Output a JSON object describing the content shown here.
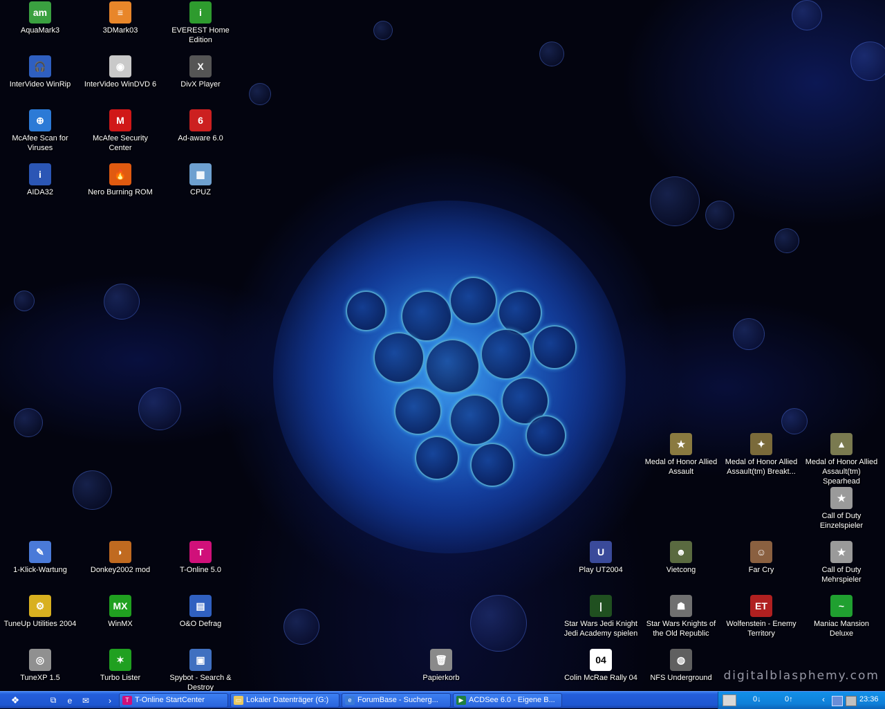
{
  "desktop": {
    "watermark": "digitalblasphemy.com",
    "icons": [
      {
        "label": "AquaMark3",
        "icon": "aquamark-icon",
        "color": "#3aa040",
        "glyph": "am"
      },
      {
        "label": "3DMark03",
        "icon": "3dmark-icon",
        "color": "#e8862a",
        "glyph": "≡"
      },
      {
        "label": "EVEREST Home Edition",
        "icon": "info-icon",
        "color": "#2e9b2e",
        "glyph": "i"
      },
      {
        "label": "InterVideo WinRip",
        "icon": "headphones-icon",
        "color": "#2f5fc0",
        "glyph": "🎧"
      },
      {
        "label": "InterVideo WinDVD 6",
        "icon": "dvd-icon",
        "color": "#c9c9c9",
        "glyph": "◉"
      },
      {
        "label": "DivX Player",
        "icon": "divx-icon",
        "color": "#555555",
        "glyph": "X"
      },
      {
        "label": "McAfee Scan for Viruses",
        "icon": "scan-target-icon",
        "color": "#2c7ad6",
        "glyph": "⊕"
      },
      {
        "label": "McAfee Security Center",
        "icon": "mcafee-icon",
        "color": "#d01818",
        "glyph": "M"
      },
      {
        "label": "Ad-aware 6.0",
        "icon": "adaware-icon",
        "color": "#cc2020",
        "glyph": "6"
      },
      {
        "label": "AIDA32",
        "icon": "computer-info-icon",
        "color": "#2b56b5",
        "glyph": "i"
      },
      {
        "label": "Nero Burning ROM",
        "icon": "nero-icon",
        "color": "#e05a10",
        "glyph": "🔥"
      },
      {
        "label": "CPUZ",
        "icon": "cpu-icon",
        "color": "#6ea0d0",
        "glyph": "▦"
      },
      {
        "label": "Medal of Honor Allied Assault",
        "icon": "medal-icon",
        "color": "#8a7a40",
        "glyph": "★"
      },
      {
        "label": "Medal of Honor Allied Assault(tm) Breakt...",
        "icon": "medal-icon",
        "color": "#7a6a3a",
        "glyph": "✦"
      },
      {
        "label": "Medal of Honor Allied Assault(tm) Spearhead",
        "icon": "medal-icon",
        "color": "#7a7a50",
        "glyph": "▲"
      },
      {
        "label": "Call of Duty Einzelspieler",
        "icon": "star-icon",
        "color": "#9a9a9a",
        "glyph": "★"
      },
      {
        "label": "1-Klick-Wartung",
        "icon": "maintenance-icon",
        "color": "#4a7ad8",
        "glyph": "✎"
      },
      {
        "label": "Donkey2002 mod",
        "icon": "donkey-icon",
        "color": "#c06a20",
        "glyph": "◗"
      },
      {
        "label": "T-Online 5.0",
        "icon": "t-online-icon",
        "color": "#d0107a",
        "glyph": "T"
      },
      {
        "label": "Play UT2004",
        "icon": "ut2004-icon",
        "color": "#3a4a9a",
        "glyph": "U"
      },
      {
        "label": "Vietcong",
        "icon": "soldier-icon",
        "color": "#5a6a40",
        "glyph": "☻"
      },
      {
        "label": "Far Cry",
        "icon": "farcry-icon",
        "color": "#8a6040",
        "glyph": "☺"
      },
      {
        "label": "Call of Duty Mehrspieler",
        "icon": "star-icon",
        "color": "#9a9a9a",
        "glyph": "★"
      },
      {
        "label": "TuneUp Utilities 2004",
        "icon": "tuneup-icon",
        "color": "#d8b020",
        "glyph": "⚙"
      },
      {
        "label": "WinMX",
        "icon": "winmx-icon",
        "color": "#20a020",
        "glyph": "MX"
      },
      {
        "label": "O&O Defrag",
        "icon": "defrag-icon",
        "color": "#3060c0",
        "glyph": "▤"
      },
      {
        "label": "Star Wars Jedi Knight Jedi Academy spielen",
        "icon": "lightsaber-icon",
        "color": "#205020",
        "glyph": "|"
      },
      {
        "label": "Star Wars Knights of the Old Republic",
        "icon": "helmet-icon",
        "color": "#707070",
        "glyph": "☗"
      },
      {
        "label": "Wolfenstein - Enemy Territory",
        "icon": "wolfenstein-icon",
        "color": "#b02020",
        "glyph": "ET"
      },
      {
        "label": "Maniac Mansion Deluxe",
        "icon": "tentacle-icon",
        "color": "#20a030",
        "glyph": "~"
      },
      {
        "label": "TuneXP 1.5",
        "icon": "tunexp-icon",
        "color": "#909090",
        "glyph": "◎"
      },
      {
        "label": "Turbo Lister",
        "icon": "turbo-lister-icon",
        "color": "#20a020",
        "glyph": "✶"
      },
      {
        "label": "Spybot - Search & Destroy",
        "icon": "spybot-icon",
        "color": "#4070c0",
        "glyph": "▣"
      },
      {
        "label": "Papierkorb",
        "icon": "recycle-bin-icon",
        "color": "#8a8a8a",
        "glyph": "🗑"
      },
      {
        "label": "Colin McRae Rally 04",
        "icon": "rally-icon",
        "color": "#ffffff",
        "glyph": "04"
      },
      {
        "label": "NFS Underground",
        "icon": "nfs-icon",
        "color": "#606060",
        "glyph": "◍"
      }
    ]
  },
  "taskbar": {
    "start_icon": "start-icon",
    "quick_launch": [
      {
        "icon": "show-desktop-icon",
        "glyph": "⧉"
      },
      {
        "icon": "internet-explorer-icon",
        "glyph": "e"
      },
      {
        "icon": "outlook-icon",
        "glyph": "✉"
      }
    ],
    "expand_glyph": "›",
    "tasks": [
      {
        "label": "T-Online StartCenter",
        "icon": "t-online-icon",
        "color": "#d0107a",
        "glyph": "T"
      },
      {
        "label": "Lokaler Datenträger (G:)",
        "icon": "folder-icon",
        "color": "#e8c860",
        "glyph": "▭"
      },
      {
        "label": "ForumBase - Sucherg...",
        "icon": "internet-explorer-icon",
        "color": "#3a7ad8",
        "glyph": "e"
      },
      {
        "label": "ACDSee 6.0 - Eigene B...",
        "icon": "acdsee-icon",
        "color": "#208040",
        "glyph": "▶"
      }
    ],
    "tray": {
      "download": "0↓",
      "upload": "0↑",
      "chevron": "‹",
      "clock": "23:36"
    }
  }
}
